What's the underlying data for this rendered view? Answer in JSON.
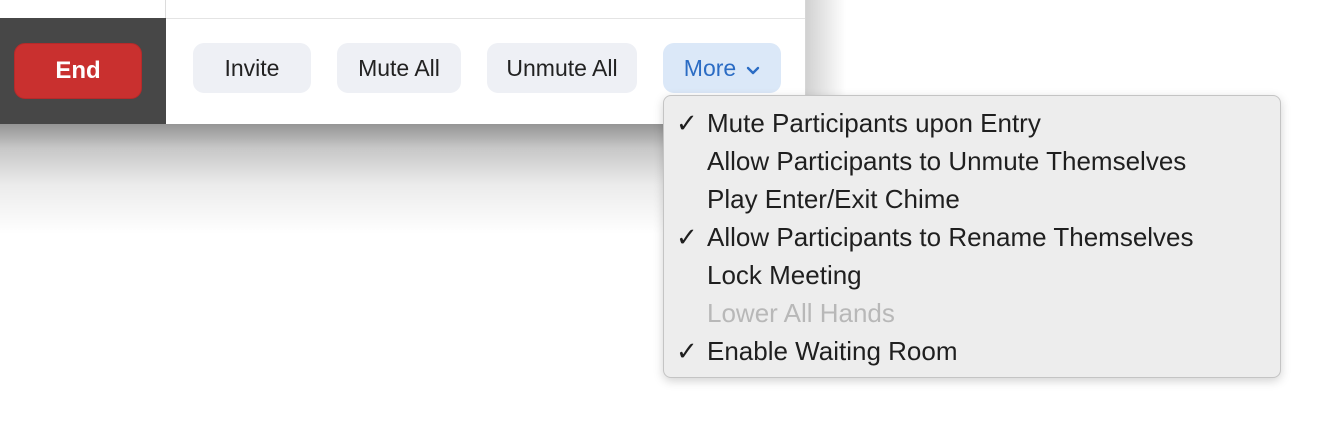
{
  "toolbar": {
    "end_label": "End",
    "invite_label": "Invite",
    "mute_all_label": "Mute All",
    "unmute_all_label": "Unmute All",
    "more_label": "More",
    "more_chevron": "⌄"
  },
  "more_menu": {
    "items": [
      {
        "label": "Mute Participants upon Entry",
        "checked": true,
        "enabled": true,
        "check": "✓"
      },
      {
        "label": "Allow Participants to Unmute Themselves",
        "checked": false,
        "enabled": true,
        "check": ""
      },
      {
        "label": "Play Enter/Exit Chime",
        "checked": false,
        "enabled": true,
        "check": ""
      },
      {
        "label": "Allow Participants to Rename Themselves",
        "checked": true,
        "enabled": true,
        "check": "✓"
      },
      {
        "label": "Lock Meeting",
        "checked": false,
        "enabled": true,
        "check": ""
      },
      {
        "label": "Lower All Hands",
        "checked": false,
        "enabled": false,
        "check": ""
      },
      {
        "label": "Enable Waiting Room",
        "checked": true,
        "enabled": true,
        "check": "✓"
      }
    ]
  },
  "colors": {
    "end_button": "#c9302f",
    "more_button_bg": "#dbe8f8",
    "more_button_text": "#2b6cc4",
    "disabled_text": "#b8b8b8"
  }
}
